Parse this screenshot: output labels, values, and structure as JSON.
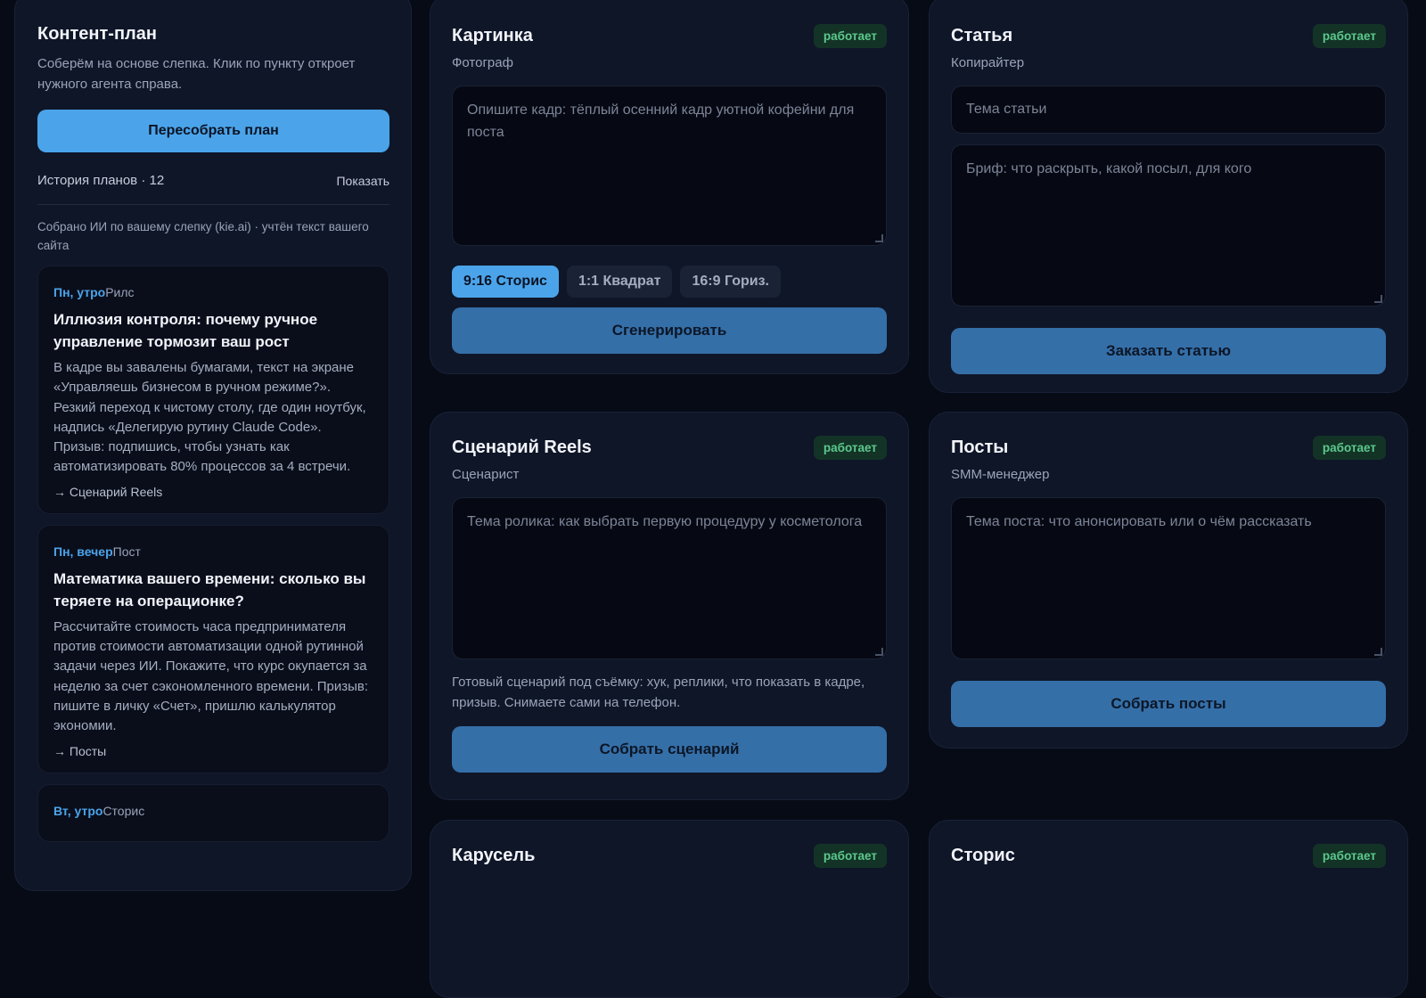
{
  "content_plan": {
    "title": "Контент-план",
    "description": "Соберём на основе слепка. Клик по пункту откроет нужного агента справа.",
    "rebuild_label": "Пересобрать план",
    "history_label": "История планов · 12",
    "history_show": "Показать",
    "ai_note": "Собрано ИИ по вашему слепку (kie.ai) · учтён текст вашего сайта",
    "items": [
      {
        "when": "Пн, утро",
        "type": "Рилс",
        "title": "Иллюзия контроля: почему ручное управление тормозит ваш рост",
        "text": "В кадре вы завалены бумагами, текст на экране «Управляешь бизнесом в ручном режиме?». Резкий переход к чистому столу, где один ноутбук, надпись «Делегирую рутину Claude Code». Призыв: подпишись, чтобы узнать как автоматизировать 80% процессов за 4 встречи.",
        "link": "→ Сценарий Reels"
      },
      {
        "when": "Пн, вечер",
        "type": "Пост",
        "title": "Математика вашего времени: сколько вы теряете на операционке?",
        "text": "Рассчитайте стоимость часа предпринимателя против стоимости автоматизации одной рутинной задачи через ИИ. Покажите, что курс окупается за неделю за счет сэкономленного времени. Призыв: пишите в личку «Счет», пришлю калькулятор экономии.",
        "link": "→ Посты"
      },
      {
        "when": "Вт, утро",
        "type": "Сторис"
      }
    ]
  },
  "status_label": "работает",
  "image_card": {
    "title": "Картинка",
    "subtitle": "Фотограф",
    "placeholder": "Опишите кадр: тёплый осенний кадр уютной кофейни для поста",
    "ratios": [
      "9:16 Сторис",
      "1:1 Квадрат",
      "16:9 Гориз."
    ],
    "button": "Сгенерировать"
  },
  "article_card": {
    "title": "Статья",
    "subtitle": "Копирайтер",
    "topic_placeholder": "Тема статьи",
    "brief_placeholder": "Бриф: что раскрыть, какой посыл, для кого",
    "button": "Заказать статью"
  },
  "reels_card": {
    "title": "Сценарий Reels",
    "subtitle": "Сценарист",
    "placeholder": "Тема ролика: как выбрать первую процедуру у косметолога",
    "hint": "Готовый сценарий под съёмку: хук, реплики, что показать в кадре, призыв. Снимаете сами на телефон.",
    "button": "Собрать сценарий"
  },
  "posts_card": {
    "title": "Посты",
    "subtitle": "SMM-менеджер",
    "placeholder": "Тема поста: что анонсировать или о чём рассказать",
    "button": "Собрать посты"
  },
  "carousel_card": {
    "title": "Карусель"
  },
  "stories_card": {
    "title": "Сторис"
  }
}
